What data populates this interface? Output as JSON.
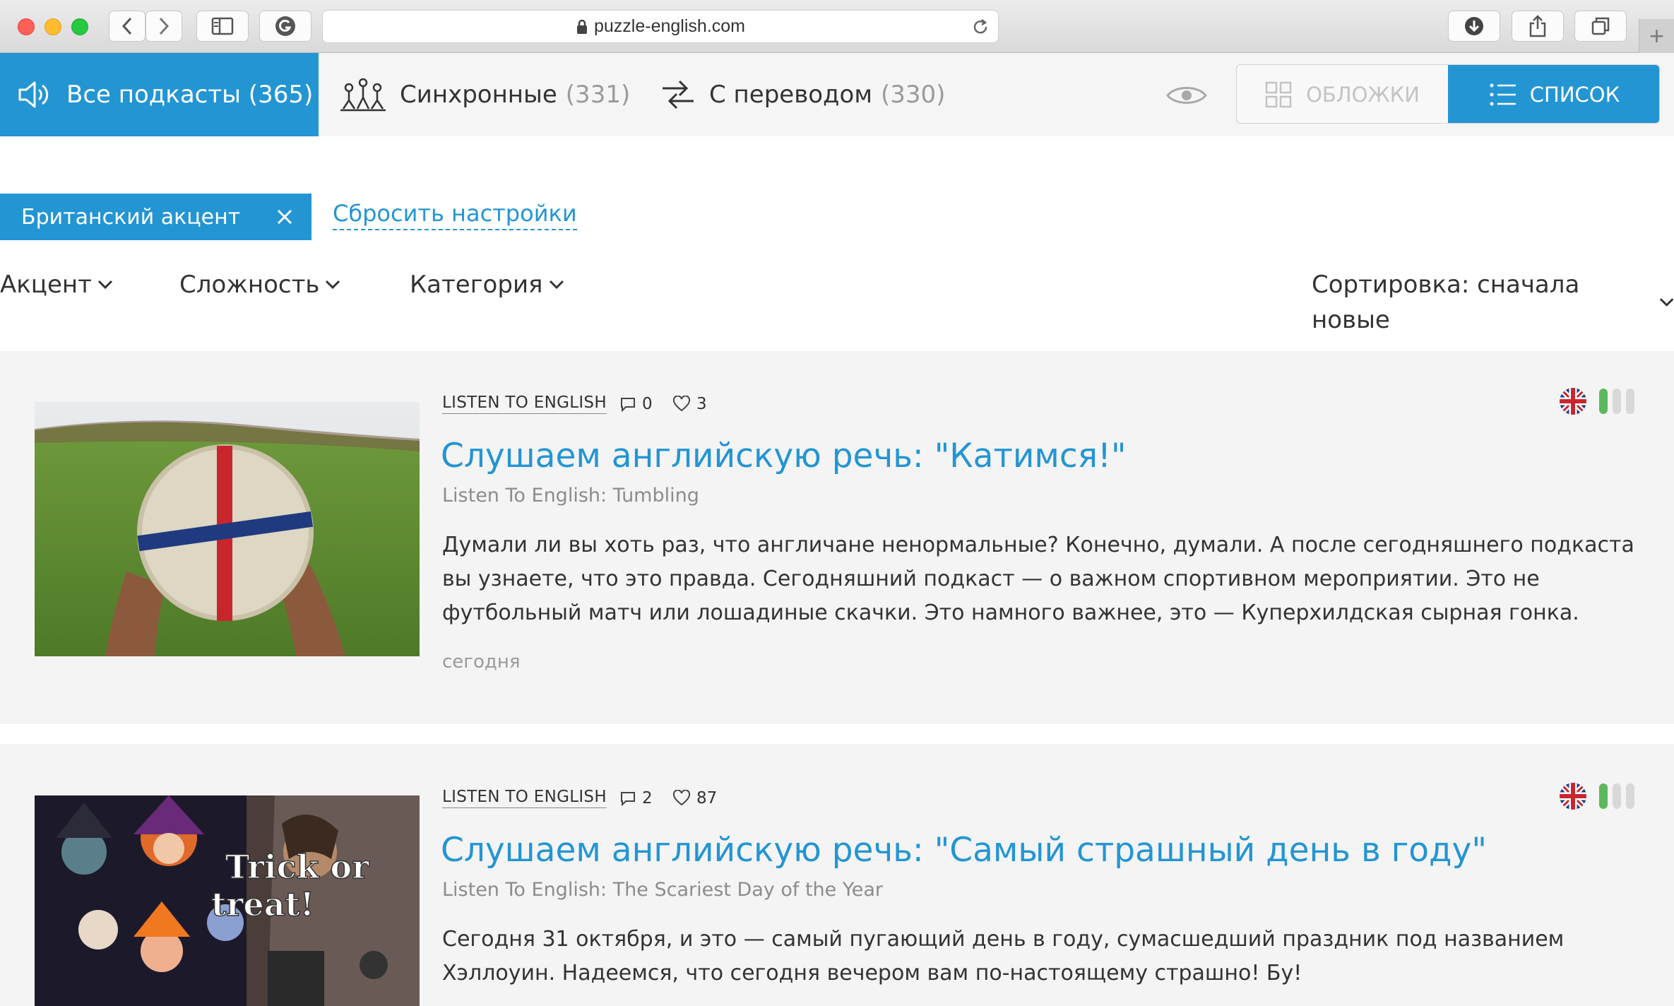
{
  "browser": {
    "url": "puzzle-english.com"
  },
  "tabs": [
    {
      "label": "Все подкасты (365)",
      "count": ""
    },
    {
      "label": "Синхронные",
      "count": "(331)"
    },
    {
      "label": "С переводом",
      "count": "(330)"
    }
  ],
  "view_toggle": {
    "covers_label": "ОБЛОЖКИ",
    "list_label": "СПИСОК"
  },
  "filters": {
    "active_chip": "Британский акцент",
    "reset_label": "Сбросить настройки",
    "accent_label": "Акцент",
    "difficulty_label": "Сложность",
    "category_label": "Категория",
    "sort_label": "Сортировка: сначала новые"
  },
  "podcasts": [
    {
      "category": "LISTEN TO ENGLISH",
      "comments": "0",
      "likes": "3",
      "title": "Слушаем английскую речь: \"Катимся!\"",
      "subtitle": "Listen To English: Tumbling",
      "description": "Думали ли вы хоть раз, что англичане ненормальные? Конечно, думали. А после сегодняшнего подкаста вы узнаете, что это правда. Сегодняшний подкаст — о важном спортивном мероприятии. Это не футбольный матч или лошадиные скачки. Это намного важнее, это — Куперхилдская сырная гонка.",
      "date": "сегодня",
      "difficulty": 1
    },
    {
      "category": "LISTEN TO ENGLISH",
      "comments": "2",
      "likes": "87",
      "title": "Слушаем английскую речь: \"Самый страшный день в году\"",
      "subtitle": "Listen To English: The Scariest Day of the Year",
      "description": "Сегодня 31 октября, и это — самый пугающий день в году, сумасшедший праздник под названием Хэллоуин. Надеемся, что сегодня вечером вам по-настоящему страшно! Бу!",
      "image_text": "Trick or treat!",
      "difficulty": 1
    }
  ],
  "colors": {
    "accent": "#2395d3",
    "difficulty_on": "#5cb85c",
    "difficulty_off": "#d8d8d8"
  }
}
